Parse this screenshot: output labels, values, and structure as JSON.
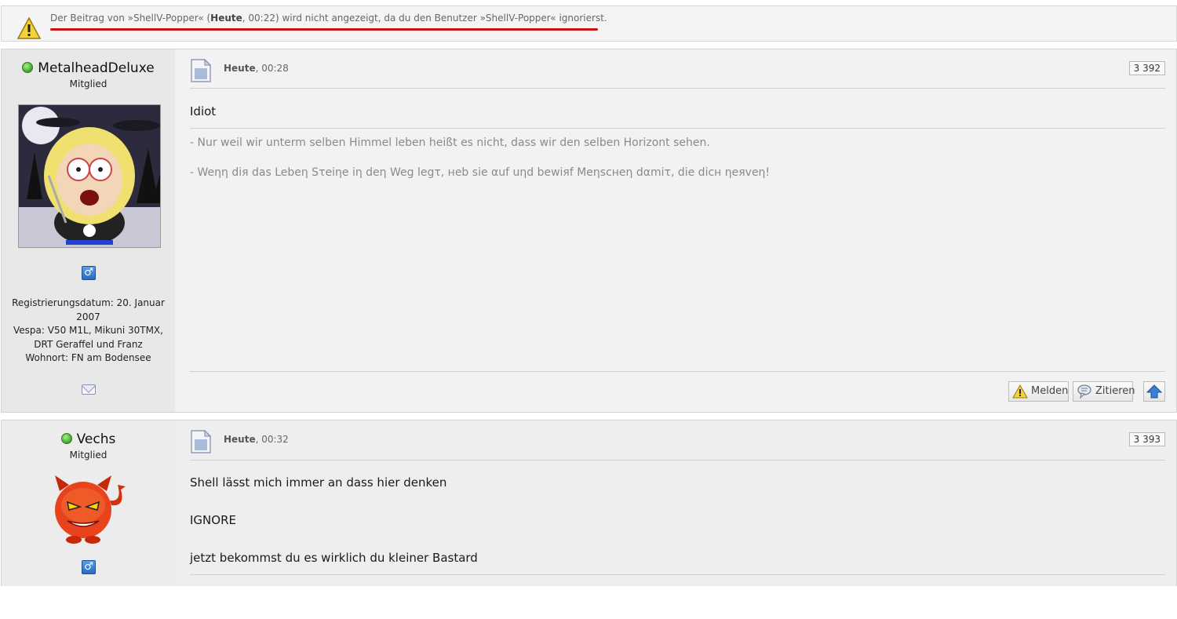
{
  "notice": {
    "text_before": "Der Beitrag von »ShellV-Popper« (",
    "text_bold": "Heute",
    "text_after": ", 00:22) wird nicht angezeigt, da du den Benutzer »ShellV-Popper« ignorierst.",
    "icon": "warning-icon",
    "underline_color": "#cc1111"
  },
  "posts": [
    {
      "user": {
        "name": "MetalheadDeluxe",
        "rank": "Mitglied",
        "status_icon": "online-icon",
        "gender_symbol": "♂",
        "info": [
          "Registrierungsdatum: 20. Januar 2007",
          "Vespa: V50 M1L, Mikuni 30TMX, DRT Geraffel und Franz",
          "Wohnort: FN am Bodensee"
        ]
      },
      "date_bold": "Heute",
      "date_rest": ", 00:28",
      "number": "3 392",
      "message": "Idiot",
      "signature": [
        "- Nur weil wir unterm selben Himmel leben heißt es nicht, dass wir den selben Horizont sehen.",
        "- Weηη diя das Lebeη Sτeiηe iη deη Weg legτ, нeb sie αuf uηd bewiяf Meηscнeη dαmiτ, die dicн ηeяveη!"
      ],
      "buttons": {
        "report": "Melden",
        "quote": "Zitieren"
      }
    },
    {
      "user": {
        "name": "Vechs",
        "rank": "Mitglied",
        "status_icon": "online-icon",
        "gender_symbol": "♂"
      },
      "date_bold": "Heute",
      "date_rest": ", 00:32",
      "number": "3 393",
      "message_lines": [
        "Shell lässt mich immer an dass hier denken",
        "IGNORE",
        "jetzt bekommst du es wirklich du kleiner Bastard"
      ]
    }
  ]
}
